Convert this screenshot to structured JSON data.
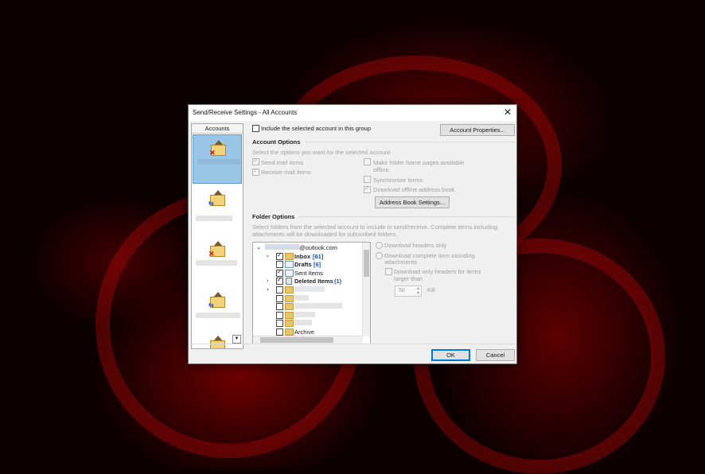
{
  "dialog": {
    "title": "Send/Receive Settings - All Accounts",
    "close_glyph": "✕"
  },
  "accounts": {
    "header": "Accounts"
  },
  "include_label": "Include the selected account in this group",
  "account_properties_button": "Account Properties...",
  "account_options": {
    "header": "Account Options",
    "description": "Select the options you want for the selected account",
    "send_mail": "Send mail items",
    "receive_mail": "Receive mail items",
    "folder_home_1": "Make folder home pages available",
    "folder_home_2": "offline",
    "sync_forms": "Synchronize forms",
    "download_oab": "Download offline address book",
    "address_book_button": "Address Book Settings..."
  },
  "folder_options": {
    "header": "Folder Options",
    "description_1": "Select folders from the selected account to include in send/receive. Complete items including",
    "description_2": "attachments will be downloaded for subscribed folders.",
    "account_root": "@outlook.com",
    "folders": {
      "inbox": "Inbox",
      "inbox_count": "[61]",
      "drafts": "Drafts",
      "drafts_count": "[6]",
      "sent": "Sent Items",
      "deleted": "Deleted Items",
      "deleted_count": "(1)",
      "archive": "Archive"
    },
    "headers_only": "Download headers only",
    "complete_1": "Download complete item including",
    "complete_2": "attachments",
    "only_headers_1": "Download only headers for items",
    "only_headers_2": "larger than",
    "size_value": "50",
    "size_unit": "KB"
  },
  "footer": {
    "ok": "OK",
    "cancel": "Cancel"
  }
}
